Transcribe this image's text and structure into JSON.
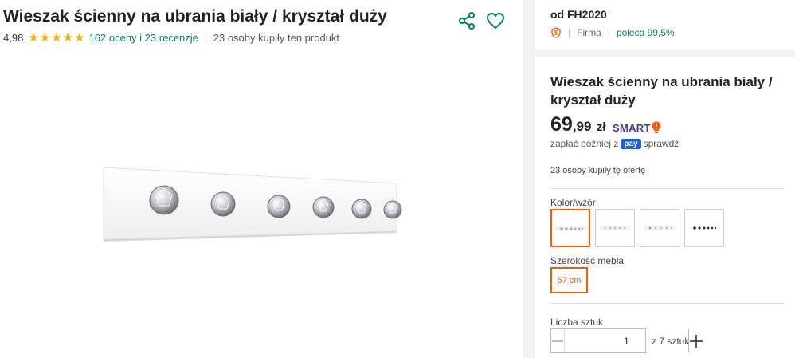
{
  "product": {
    "title": "Wieszak ścienny na ubrania biały / kryształ duży",
    "rating": "4,98",
    "stars": 5,
    "reviews_link": "162 oceny i 23 recenzje",
    "buyers_count": "23 osoby kupiły ten produkt"
  },
  "seller": {
    "name": "od FH2020",
    "type": "Firma",
    "recommend": "poleca 99,5%"
  },
  "offer": {
    "title": "Wieszak ścienny na ubrania biały / kryształ duży",
    "price_int": "69",
    "price_dec": ",99",
    "currency": "zł",
    "smart_label": "SMART",
    "pay_later_prefix": "zapłać później z",
    "pay_badge": "pay",
    "pay_later_link": "sprawdź",
    "buyers": "23 osoby kupiły tę ofertę",
    "color_label": "Kolor/wzór",
    "width_label": "Szerokość mebla",
    "width_option": "57 cm",
    "qty_label": "Liczba sztuk",
    "qty_value": "1",
    "qty_of": "z 7 sztuk"
  },
  "colors": {
    "accent": "#ff5a00",
    "link": "#00806a",
    "star": "#f5b000"
  }
}
